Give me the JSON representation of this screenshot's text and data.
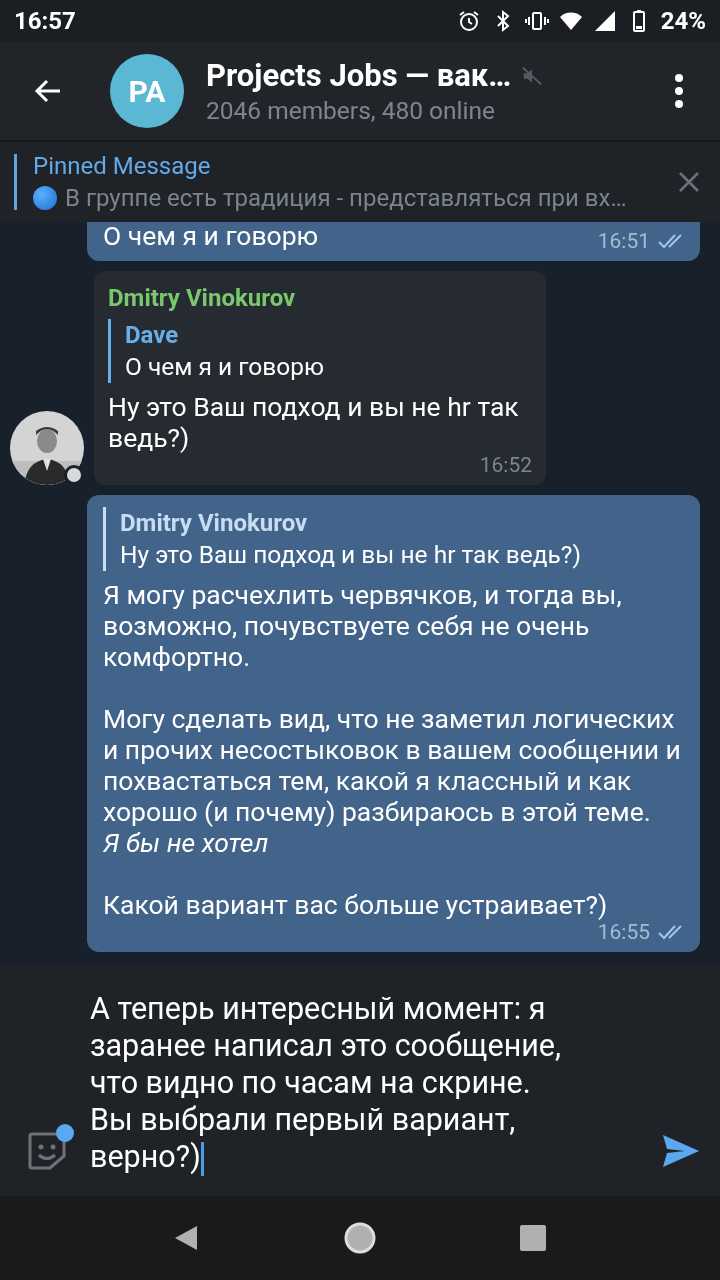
{
  "status_bar": {
    "time": "16:57",
    "battery": "24%"
  },
  "header": {
    "avatar_initials": "PA",
    "title": "Projects Jobs — вак…",
    "subtitle": "2046 members, 480 online",
    "muted": true
  },
  "pinned": {
    "label": "Pinned Message",
    "text": "В группе есть традиция - представляться при вх…"
  },
  "messages": [
    {
      "kind": "outgoing",
      "paragraphs": [
        "О чем я и говорю"
      ],
      "time": "16:51",
      "read": true
    },
    {
      "kind": "incoming",
      "sender": "Dmitry Vinokurov",
      "reply": {
        "name": "Dave",
        "text": "О чем я и говорю"
      },
      "paragraphs": [
        "Ну это Ваш подход и вы не hr так ведь?)"
      ],
      "time": "16:52"
    },
    {
      "kind": "outgoing",
      "reply": {
        "name": "Dmitry Vinokurov",
        "text": "Ну это Ваш подход и вы не hr так ведь?)"
      },
      "paragraphs": [
        "Я могу расчехлить червячков, и тогда вы, возможно, почувствуете себя не очень комфортно.",
        "Могу сделать вид, что не заметил логических и прочих несостыковок в вашем сообщении и похвастаться тем, какой я классный и как хорошо (и почему) разбираюсь в этой теме.\n*Я бы не хотел*",
        "Какой вариант вас больше устраивает?)"
      ],
      "time": "16:55",
      "read": true
    }
  ],
  "composer": {
    "value": "А теперь интересный момент: я заранее написал это сообщение, что видно по часам на скрине. Вы выбрали первый вариант, верно?)",
    "sticker_badge": true
  }
}
